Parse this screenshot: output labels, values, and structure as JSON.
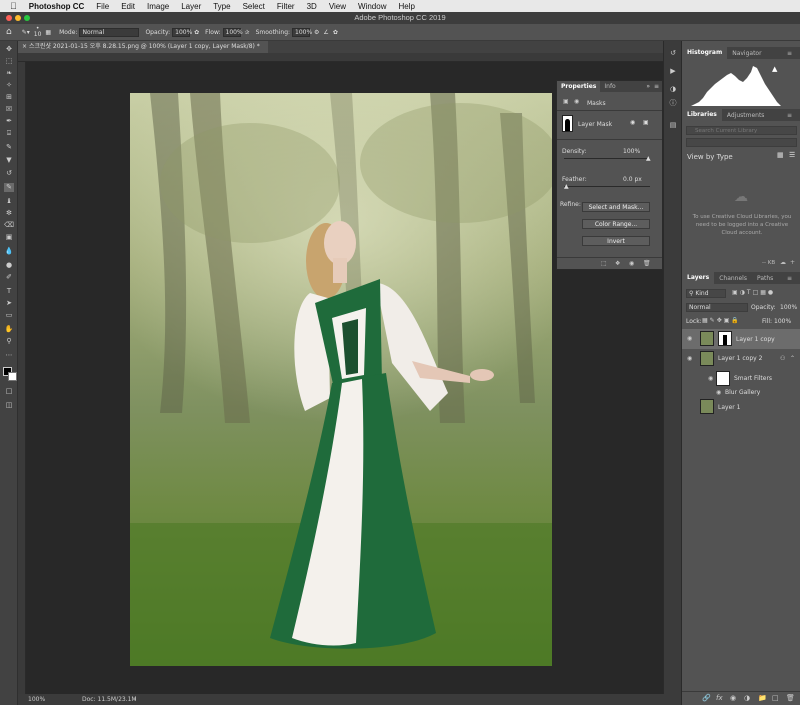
{
  "menu": {
    "apple": "",
    "items": [
      "Photoshop CC",
      "File",
      "Edit",
      "Image",
      "Layer",
      "Type",
      "Select",
      "Filter",
      "3D",
      "View",
      "Window",
      "Help"
    ]
  },
  "window_title": "Adobe Photoshop CC 2019",
  "options": {
    "brush_size": "10",
    "mode_label": "Mode:",
    "mode_value": "Normal",
    "opacity_label": "Opacity:",
    "opacity_value": "100%",
    "flow_label": "Flow:",
    "flow_value": "100%",
    "smoothing_label": "Smoothing:",
    "smoothing_value": "100%"
  },
  "doc_tab": "스크린샷 2021-01-15 오후 8.28.15.png @ 100% (Layer 1 copy, Layer Mask/8) *",
  "status": {
    "zoom": "100%",
    "doc": "Doc: 11.5M/23.1M"
  },
  "properties": {
    "tab_properties": "Properties",
    "tab_info": "Info",
    "section": "Masks",
    "mask_label": "Layer Mask",
    "density_label": "Density:",
    "density_value": "100%",
    "density_level": 1.0,
    "feather_label": "Feather:",
    "feather_value": "0.0 px",
    "feather_level": 0.0,
    "refine_label": "Refine:",
    "btn_select_mask": "Select and Mask...",
    "btn_color_range": "Color Range...",
    "btn_invert": "Invert"
  },
  "histogram": {
    "tab1": "Histogram",
    "tab2": "Navigator"
  },
  "libraries": {
    "tab1": "Libraries",
    "tab2": "Adjustments",
    "search_placeholder": "Search Current Library",
    "view_by": "View by Type",
    "message": "To use Creative Cloud Libraries, you need to be logged into a Creative Cloud account.",
    "size": "-- KB"
  },
  "layers_panel": {
    "tab1": "Layers",
    "tab2": "Channels",
    "tab3": "Paths",
    "kind": "Kind",
    "blend": "Normal",
    "opacity_label": "Opacity:",
    "opacity_value": "100%",
    "lock_label": "Lock:",
    "fill_label": "Fill:",
    "fill_value": "100%",
    "layers": [
      {
        "name": "Layer 1 copy"
      },
      {
        "name": "Layer 1 copy 2"
      },
      {
        "name": "Smart Filters"
      },
      {
        "name": "Blur Gallery"
      },
      {
        "name": "Layer 1"
      }
    ]
  },
  "colors": {
    "dress_green": "#1f6b3b",
    "panel_bg": "#535353",
    "canvas_bg": "#282828"
  }
}
